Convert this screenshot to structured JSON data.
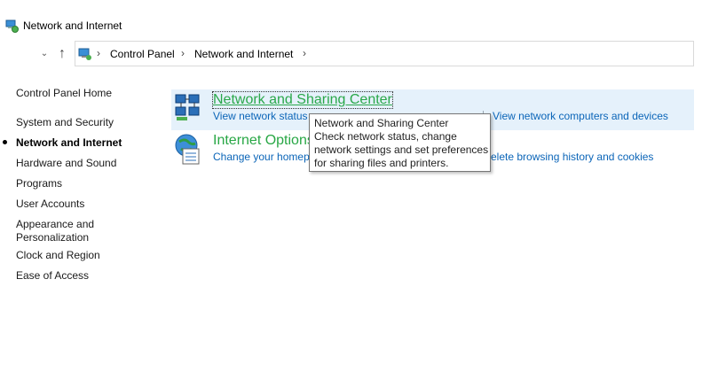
{
  "window": {
    "title": "Network and Internet",
    "icon": "network-internet-icon"
  },
  "nav": {
    "dropdown_icon": "chevron-down-icon",
    "up_icon": "up-arrow-icon",
    "address_icon": "control-panel-icon",
    "breadcrumb": [
      {
        "label": "Control Panel"
      },
      {
        "label": "Network and Internet"
      }
    ]
  },
  "sidebar": {
    "home": "Control Panel Home",
    "items": [
      {
        "label": "System and Security",
        "active": false
      },
      {
        "label": "Network and Internet",
        "active": true
      },
      {
        "label": "Hardware and Sound",
        "active": false
      },
      {
        "label": "Programs",
        "active": false
      },
      {
        "label": "User Accounts",
        "active": false
      },
      {
        "label": "Appearance and",
        "label2": "Personalization",
        "active": false
      },
      {
        "label": "Clock and Region",
        "active": false
      },
      {
        "label": "Ease of Access",
        "active": false
      }
    ]
  },
  "categories": [
    {
      "title": "Network and Sharing Center",
      "icon": "network-sharing-center-icon",
      "links": [
        "View network status",
        "View network computers and devices"
      ]
    },
    {
      "title": "Internet Options",
      "icon": "internet-options-icon",
      "links": [
        "Change your homep",
        "elete browsing history and cookies"
      ]
    }
  ],
  "tooltip": {
    "lines": [
      "Network and Sharing Center",
      "Check network status, change",
      "network settings and set preferences",
      "for sharing files and printers."
    ]
  },
  "colors": {
    "link": "#0b65b8",
    "category_title": "#28a745",
    "highlight": "#e5f1fb"
  }
}
